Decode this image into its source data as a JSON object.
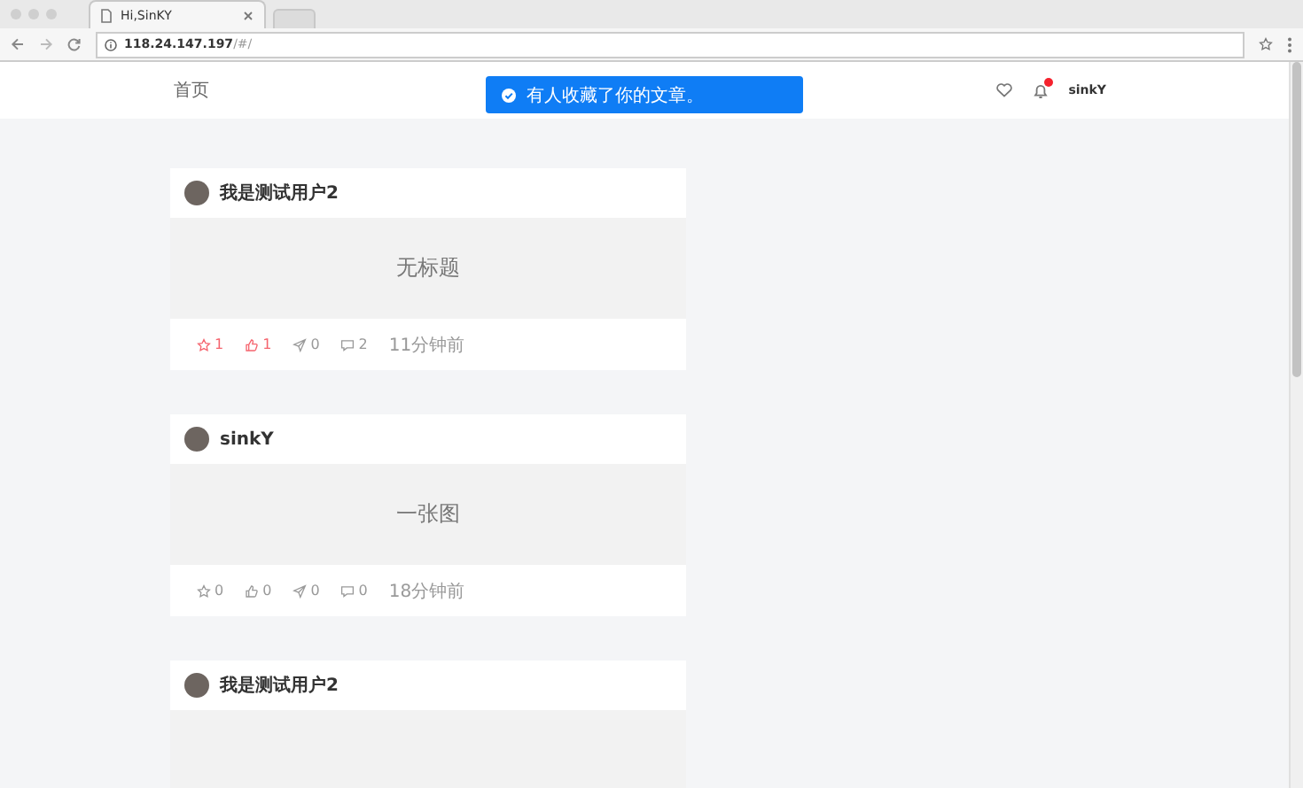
{
  "browser": {
    "tab_title": "Hi,SinKY",
    "address": "**118.24.147.197**/#/"
  },
  "navbar": {
    "home_link": "首页",
    "notifications_unread": true,
    "username": "sinkY"
  },
  "toast": {
    "message": "有人收藏了你的文章。"
  },
  "posts": [
    {
      "author": "我是测试用户2",
      "title": "无标题",
      "stats": [
        {
          "kind": "star",
          "count": "1",
          "active": true
        },
        {
          "kind": "like",
          "count": "1",
          "active": true
        },
        {
          "kind": "share",
          "count": "0",
          "active": false
        },
        {
          "kind": "comment",
          "count": "2",
          "active": false
        }
      ],
      "time": "11分钟前"
    },
    {
      "author": "sinkY",
      "title": "一张图",
      "stats": [
        {
          "kind": "star",
          "count": "0",
          "active": false
        },
        {
          "kind": "like",
          "count": "0",
          "active": false
        },
        {
          "kind": "share",
          "count": "0",
          "active": false
        },
        {
          "kind": "comment",
          "count": "0",
          "active": false
        }
      ],
      "time": "18分钟前"
    },
    {
      "author": "我是测试用户2"
    }
  ]
}
